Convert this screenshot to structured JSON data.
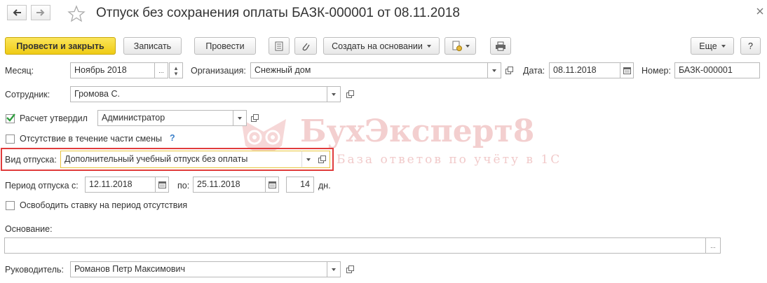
{
  "header": {
    "title": "Отпуск без сохранения оплаты БАЗК-000001 от 08.11.2018"
  },
  "toolbar": {
    "post_close": "Провести и закрыть",
    "save": "Записать",
    "post": "Провести",
    "create_based": "Создать на основании",
    "more": "Еще",
    "help": "?"
  },
  "form": {
    "month_label": "Месяц:",
    "month_value": "Ноябрь 2018",
    "month_button": "...",
    "org_label": "Организация:",
    "org_value": "Снежный дом",
    "date_label": "Дата:",
    "date_value": "08.11.2018",
    "number_label": "Номер:",
    "number_value": "БАЗК-000001",
    "employee_label": "Сотрудник:",
    "employee_value": "Громова С.",
    "approved_label": "Расчет утвердил",
    "approved_checked": true,
    "approver_value": "Администратор",
    "partial_label": "Отсутствие в течение части смены",
    "partial_checked": false,
    "help_mark": "?",
    "leave_type_label": "Вид отпуска:",
    "leave_type_value": "Дополнительный учебный отпуск без оплаты",
    "period_label": "Период отпуска с:",
    "period_from": "12.11.2018",
    "period_to_label": "по:",
    "period_to": "25.11.2018",
    "days_value": "14",
    "days_unit": "дн.",
    "release_label": "Освободить ставку на период отсутствия",
    "release_checked": false,
    "basis_label": "Основание:",
    "basis_value": "",
    "basis_button": "...",
    "manager_label": "Руководитель:",
    "manager_value": "Романов Петр Максимович"
  },
  "watermark": {
    "brand": "БухЭксперт8",
    "tagline": "База ответов по учёту в 1С"
  },
  "colors": {
    "highlight": "#e03c3c",
    "primary_button": "#f5d52d",
    "focus_border": "#e8c23a",
    "checkmark": "#2e9e3e",
    "help": "#3a7fc9"
  }
}
